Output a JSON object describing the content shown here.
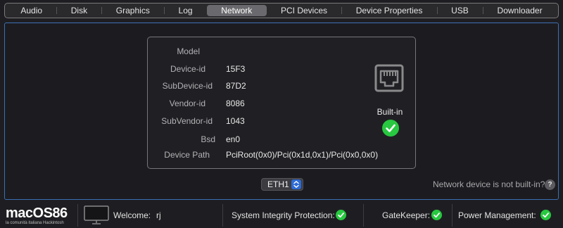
{
  "tabs": [
    {
      "label": "Audio"
    },
    {
      "label": "Disk"
    },
    {
      "label": "Graphics"
    },
    {
      "label": "Log"
    },
    {
      "label": "Network"
    },
    {
      "label": "PCI Devices"
    },
    {
      "label": "Device Properties"
    },
    {
      "label": "USB"
    },
    {
      "label": "Downloader"
    }
  ],
  "active_tab": "Network",
  "device": {
    "model_label": "Model",
    "model_value": "",
    "device_id_label": "Device-id",
    "device_id_value": "15F3",
    "subdevice_id_label": "SubDevice-id",
    "subdevice_id_value": "87D2",
    "vendor_id_label": "Vendor-id",
    "vendor_id_value": "8086",
    "subvendor_id_label": "SubVendor-id",
    "subvendor_id_value": "1043",
    "bsd_label": "Bsd",
    "bsd_value": "en0",
    "device_path_label": "Device Path",
    "device_path_value": "PciRoot(0x0)/Pci(0x1d,0x1)/Pci(0x0,0x0)",
    "builtin_label": "Built-in",
    "builtin_checked": true,
    "port_icon": "ethernet-port-icon"
  },
  "interface_select": {
    "value": "ETH1"
  },
  "not_builtin_question": "Network device is not built-in?",
  "help_label": "?",
  "footer": {
    "logo_text": "macOS86",
    "logo_tagline": "la comunità italiana Hackintosh",
    "welcome_label": "Welcome:",
    "user": "rj",
    "sip_label": "System Integrity Protection:",
    "gatekeeper_label": "GateKeeper:",
    "power_label": "Power Management:"
  },
  "colors": {
    "accent": "#3d6fb5",
    "check_green": "#28c840",
    "select_blue": "#2d6bd6"
  }
}
